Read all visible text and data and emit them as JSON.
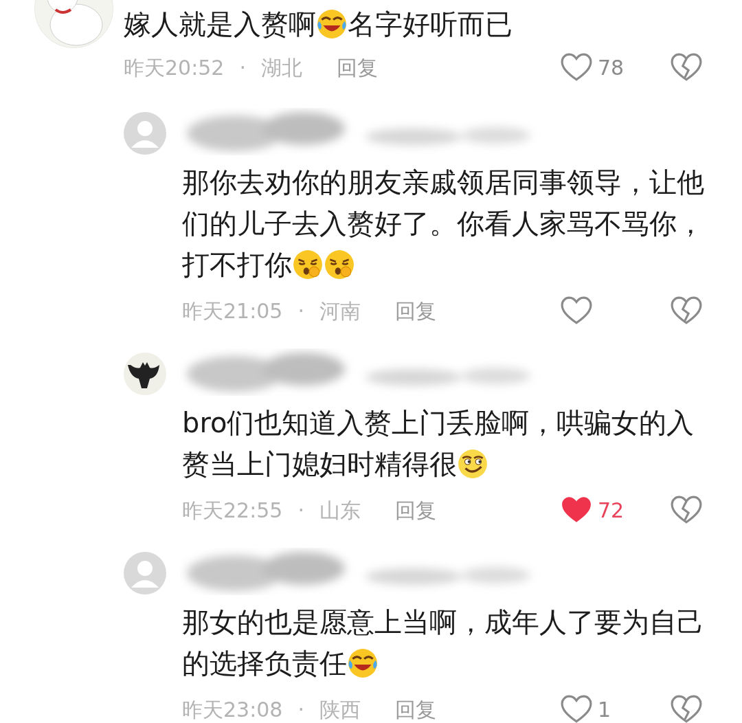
{
  "comments": [
    {
      "avatar": {
        "kind": "picture"
      },
      "lines": [
        [
          {
            "kind": "text",
            "text": "嫁人就是入赘啊"
          },
          {
            "kind": "laugh-cry"
          },
          {
            "kind": "text",
            "text": "名字好听而已"
          }
        ]
      ],
      "time": "昨天20:52",
      "dot": "·",
      "region": "湖北",
      "reply": "回复",
      "likes": "78",
      "liked": false,
      "replies": [
        {
          "avatar": {
            "kind": "default"
          },
          "lines": [
            [
              {
                "kind": "text",
                "text": "那你去劝你的朋友亲戚领居同事领导，让他"
              }
            ],
            [
              {
                "kind": "text",
                "text": "们的儿子去入赘好了。你看人家骂不骂你，"
              }
            ],
            [
              {
                "kind": "text",
                "text": "打不打你"
              },
              {
                "kind": "shush"
              },
              {
                "kind": "shush"
              }
            ]
          ],
          "time": "昨天21:05",
          "dot": "·",
          "region": "河南",
          "reply": "回复",
          "liked": false
        },
        {
          "avatar": {
            "kind": "bat"
          },
          "lines": [
            [
              {
                "kind": "text",
                "text": "bro们也知道入赘上门丢脸啊，哄骗女的入"
              }
            ],
            [
              {
                "kind": "text",
                "text": "赘当上门媳妇时精得很"
              },
              {
                "kind": "smirk"
              }
            ]
          ],
          "time": "昨天22:55",
          "dot": "·",
          "region": "山东",
          "reply": "回复",
          "likes": "72",
          "liked": true
        },
        {
          "avatar": {
            "kind": "default"
          },
          "lines": [
            [
              {
                "kind": "text",
                "text": "那女的也是愿意上当啊，成年人了要为自己"
              }
            ],
            [
              {
                "kind": "text",
                "text": "的选择负责任"
              },
              {
                "kind": "laugh-cry"
              }
            ]
          ],
          "time": "昨天23:08",
          "dot": "·",
          "region": "陕西",
          "reply": "回复",
          "likes": "1",
          "liked": false
        }
      ]
    }
  ]
}
